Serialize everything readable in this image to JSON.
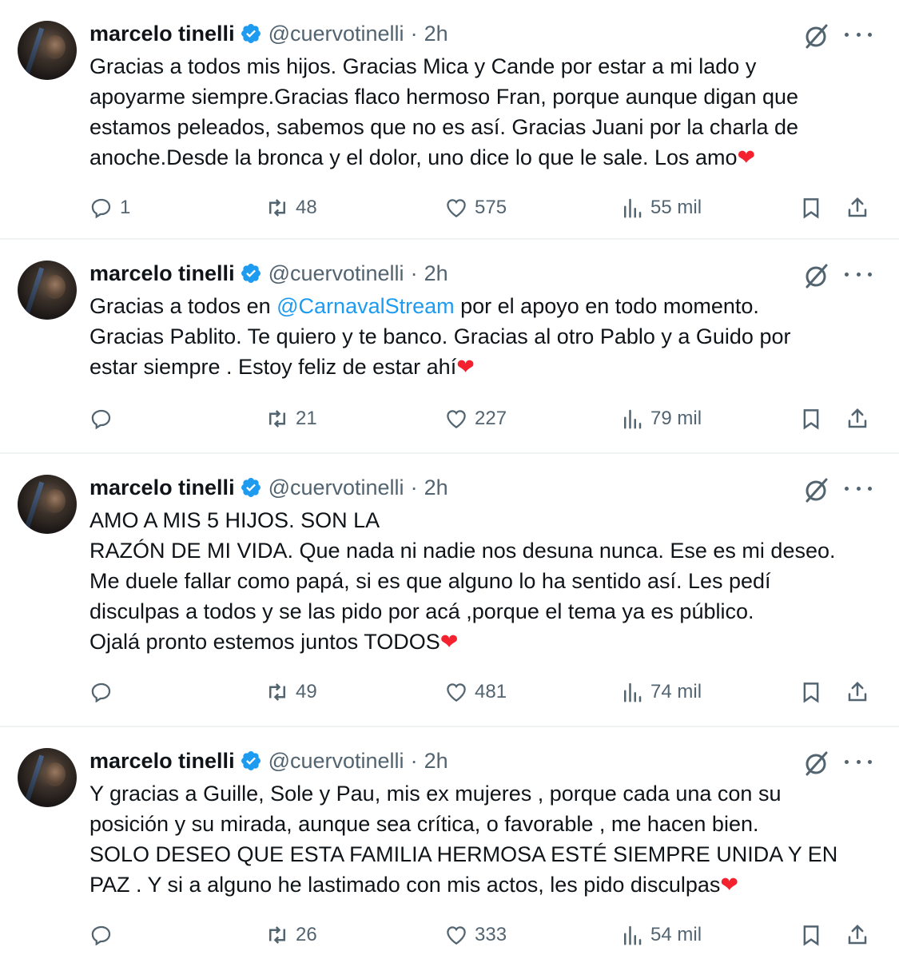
{
  "tweets": [
    {
      "author": {
        "name": "marcelo tinelli",
        "handle": "@cuervotinelli",
        "time": "2h"
      },
      "lines": [
        [
          {
            "t": "Gracias a todos mis hijos. Gracias Mica y Cande por estar a mi lado y"
          }
        ],
        [
          {
            "t": "apoyarme siempre.Gracias flaco hermoso Fran, porque aunque digan que"
          }
        ],
        [
          {
            "t": "estamos peleados, sabemos que no es así. Gracias Juani por la charla de"
          }
        ],
        [
          {
            "t": "anoche.Desde la bronca y el dolor, uno dice lo que le sale. Los amo"
          },
          {
            "t": "❤",
            "c": "heart"
          }
        ]
      ],
      "stats": {
        "replies": "1",
        "retweets": "48",
        "likes": "575",
        "views": "55 mil"
      }
    },
    {
      "author": {
        "name": "marcelo tinelli",
        "handle": "@cuervotinelli",
        "time": "2h"
      },
      "lines": [
        [
          {
            "t": "Gracias a todos en "
          },
          {
            "t": "@CarnavalStream",
            "c": "mention"
          },
          {
            "t": " por el apoyo en todo momento."
          }
        ],
        [
          {
            "t": "Gracias Pablito. Te quiero y te banco. Gracias al otro Pablo y a Guido por"
          }
        ],
        [
          {
            "t": "estar siempre . Estoy feliz de estar ahí"
          },
          {
            "t": "❤",
            "c": "heart"
          }
        ]
      ],
      "stats": {
        "replies": "",
        "retweets": "21",
        "likes": "227",
        "views": "79 mil"
      }
    },
    {
      "author": {
        "name": "marcelo tinelli",
        "handle": "@cuervotinelli",
        "time": "2h"
      },
      "lines": [
        [
          {
            "t": "AMO A MIS 5 HIJOS. SON LA"
          }
        ],
        [
          {
            "t": "RAZÓN DE MI VIDA. Que nada ni nadie nos desuna nunca. Ese es mi deseo."
          }
        ],
        [
          {
            "t": "Me duele fallar  como papá, si es que alguno lo ha sentido así. Les pedí"
          }
        ],
        [
          {
            "t": "disculpas a todos y se las pido por acá ,porque el tema ya es público."
          }
        ],
        [
          {
            "t": "Ojalá pronto estemos juntos TODOS"
          },
          {
            "t": "❤",
            "c": "heart"
          }
        ]
      ],
      "stats": {
        "replies": "",
        "retweets": "49",
        "likes": "481",
        "views": "74 mil"
      }
    },
    {
      "author": {
        "name": "marcelo tinelli",
        "handle": "@cuervotinelli",
        "time": "2h"
      },
      "lines": [
        [
          {
            "t": "Y gracias a Guille, Sole y Pau, mis ex mujeres , porque cada una con su"
          }
        ],
        [
          {
            "t": "posición y su mirada, aunque sea crítica, o favorable , me hacen bien."
          }
        ],
        [
          {
            "t": "SOLO DESEO QUE ESTA FAMILIA HERMOSA ESTÉ SIEMPRE UNIDA Y EN"
          }
        ],
        [
          {
            "t": "PAZ . Y si a alguno he lastimado con mis actos, les pido disculpas"
          },
          {
            "t": "❤",
            "c": "heart"
          }
        ]
      ],
      "stats": {
        "replies": "",
        "retweets": "26",
        "likes": "333",
        "views": "54 mil"
      }
    }
  ],
  "icons": {
    "verified": "verified-badge-icon",
    "grok": "grok-icon",
    "more": "more-icon",
    "reply": "reply-icon",
    "retweet": "retweet-icon",
    "like": "heart-icon",
    "views": "views-icon",
    "bookmark": "bookmark-icon",
    "share": "share-icon"
  },
  "colors": {
    "text": "#0f1419",
    "secondary": "#536471",
    "link": "#1d9bf0",
    "verified": "#1d9bf0",
    "heart": "#f4212e",
    "divider": "#eff3f4"
  }
}
